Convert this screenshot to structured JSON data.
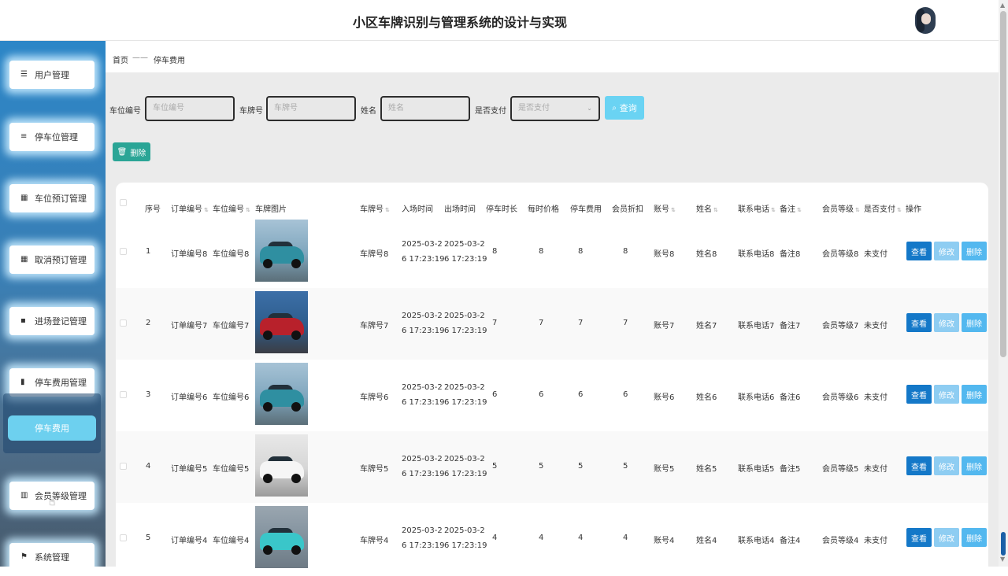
{
  "header": {
    "title": "小区车牌识别与管理系统的设计与实现"
  },
  "sidebar": {
    "items": [
      {
        "label": "用户管理",
        "icon": "list-icon"
      },
      {
        "label": "停车位管理",
        "icon": "sliders-icon"
      },
      {
        "label": "车位预订管理",
        "icon": "grid-icon"
      },
      {
        "label": "取消预订管理",
        "icon": "grid-icon"
      },
      {
        "label": "进场登记管理",
        "icon": "message-icon"
      },
      {
        "label": "停车费用管理",
        "icon": "book-icon"
      },
      {
        "label": "会员等级管理",
        "icon": "bar-chart-icon"
      },
      {
        "label": "系统管理",
        "icon": "flag-icon"
      }
    ],
    "active_sub": "停车费用"
  },
  "breadcrumb": {
    "home": "首页",
    "separator": "——",
    "current": "停车费用"
  },
  "filters": {
    "spot_label": "车位编号",
    "spot_placeholder": "车位编号",
    "plate_label": "车牌号",
    "plate_placeholder": "车牌号",
    "name_label": "姓名",
    "name_placeholder": "姓名",
    "paid_label": "是否支付",
    "paid_placeholder": "是否支付",
    "search_label": "查询"
  },
  "toolbar": {
    "delete_label": "删除"
  },
  "table": {
    "headers": [
      "序号",
      "订单编号",
      "车位编号",
      "车牌图片",
      "车牌号",
      "入场时间",
      "出场时间",
      "停车时长",
      "每时价格",
      "停车费用",
      "会员折扣",
      "账号",
      "姓名",
      "联系电话",
      "备注",
      "会员等级",
      "是否支付",
      "操作"
    ],
    "rows": [
      {
        "idx": "1",
        "order": "订单编号8",
        "spot": "车位编号8",
        "plate": "车牌号8",
        "in1": "2025-03-2",
        "in2": "6 17:23:19",
        "out1": "2025-03-2",
        "out2": "6 17:23:19",
        "dur": "8",
        "price": "8",
        "fee": "8",
        "disc": "8",
        "acct": "账号8",
        "name": "姓名8",
        "phone": "联系电话8",
        "note": "备注8",
        "level": "会员等级8",
        "paid": "未支付"
      },
      {
        "idx": "2",
        "order": "订单编号7",
        "spot": "车位编号7",
        "plate": "车牌号7",
        "in1": "2025-03-2",
        "in2": "6 17:23:19",
        "out1": "2025-03-2",
        "out2": "6 17:23:19",
        "dur": "7",
        "price": "7",
        "fee": "7",
        "disc": "7",
        "acct": "账号7",
        "name": "姓名7",
        "phone": "联系电话7",
        "note": "备注7",
        "level": "会员等级7",
        "paid": "未支付"
      },
      {
        "idx": "3",
        "order": "订单编号6",
        "spot": "车位编号6",
        "plate": "车牌号6",
        "in1": "2025-03-2",
        "in2": "6 17:23:19",
        "out1": "2025-03-2",
        "out2": "6 17:23:19",
        "dur": "6",
        "price": "6",
        "fee": "6",
        "disc": "6",
        "acct": "账号6",
        "name": "姓名6",
        "phone": "联系电话6",
        "note": "备注6",
        "level": "会员等级6",
        "paid": "未支付"
      },
      {
        "idx": "4",
        "order": "订单编号5",
        "spot": "车位编号5",
        "plate": "车牌号5",
        "in1": "2025-03-2",
        "in2": "6 17:23:19",
        "out1": "2025-03-2",
        "out2": "6 17:23:19",
        "dur": "5",
        "price": "5",
        "fee": "5",
        "disc": "5",
        "acct": "账号5",
        "name": "姓名5",
        "phone": "联系电话5",
        "note": "备注5",
        "level": "会员等级5",
        "paid": "未支付"
      },
      {
        "idx": "5",
        "order": "订单编号4",
        "spot": "车位编号4",
        "plate": "车牌号4",
        "in1": "2025-03-2",
        "in2": "6 17:23:19",
        "out1": "2025-03-2",
        "out2": "6 17:23:19",
        "dur": "4",
        "price": "4",
        "fee": "4",
        "disc": "4",
        "acct": "账号4",
        "name": "姓名4",
        "phone": "联系电话4",
        "note": "备注4",
        "level": "会员等级4",
        "paid": "未支付"
      }
    ],
    "actions": {
      "view": "查看",
      "edit": "修改",
      "delete": "删除"
    }
  },
  "colors": {
    "primary": "#1478c8",
    "search": "#6ad3f3",
    "delete": "#2aa596",
    "sidebar_top": "#2c86c7"
  }
}
